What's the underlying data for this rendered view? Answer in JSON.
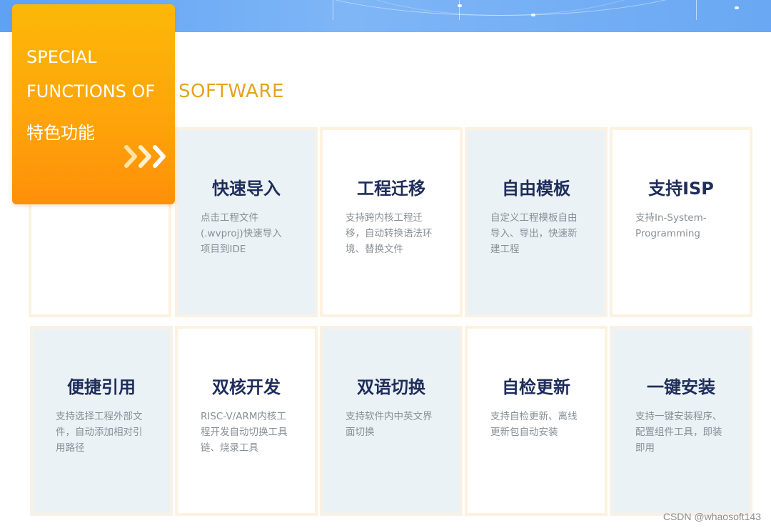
{
  "callout": {
    "line1": "SPECIAL",
    "line2": "FUNCTIONS OF",
    "line3": "特色功能"
  },
  "heading_cont": "SOFTWARE",
  "features": [
    {
      "title": "快速导入",
      "desc": "点击工程文件(.wvproj)快速导入项目到IDE"
    },
    {
      "title": "工程迁移",
      "desc": "支持跨内核工程迁移，自动转换语法环境、替换文件"
    },
    {
      "title": "自由模板",
      "desc": "自定义工程模板自由导入、导出，快速新建工程"
    },
    {
      "title": "支持ISP",
      "desc": "支持In-System-Programming"
    },
    {
      "title": "便捷引用",
      "desc": "支持选择工程外部文件，自动添加相对引用路径"
    },
    {
      "title": "双核开发",
      "desc": "RISC-V/ARM内核工程开发自动切换工具链、烧录工具"
    },
    {
      "title": "双语切换",
      "desc": "支持软件内中英文界面切换"
    },
    {
      "title": "自检更新",
      "desc": "支持自检更新、离线更新包自动安装"
    },
    {
      "title": "一键安装",
      "desc": "支持一键安装程序、配置组件工具，即装即用"
    }
  ],
  "watermark": "CSDN @whaosoft143",
  "colors": {
    "accent_orange": "#fea30a",
    "heading_gold": "#e3a41f",
    "title_navy": "#1f2d5c",
    "banner_blue": "#5ea2f4"
  }
}
